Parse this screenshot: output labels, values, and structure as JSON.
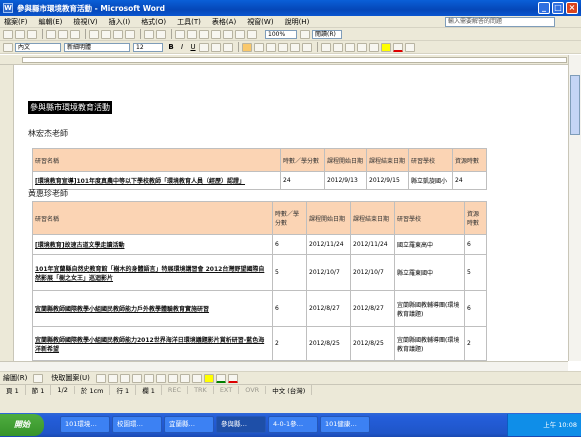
{
  "window": {
    "title": "參與縣市環境教育活動 - Microsoft Word"
  },
  "menu": [
    "檔案(F)",
    "編輯(E)",
    "檢視(V)",
    "插入(I)",
    "格式(O)",
    "工具(T)",
    "表格(A)",
    "視窗(W)",
    "說明(H)"
  ],
  "help_placeholder": "輸入需要解答的問題",
  "toolbar": {
    "zoom": "100%",
    "read": "閱讀(R)",
    "style": "內文",
    "font": "新細明體",
    "size": "12"
  },
  "doc": {
    "heading": "參與縣市環境教育活動",
    "teacher1": "林宏杰老師",
    "teacher2": "黃惠珍老師",
    "table1": {
      "headers": [
        "研習名稱",
        "時數／學分數",
        "課程開始日期",
        "課程結束日期",
        "研習學校",
        "資源時數"
      ],
      "rows": [
        [
          "[環境教育宣導]101年度真農中等以下學校教師「環境教育人員（經歷）認證」",
          "24",
          "2012/9/13",
          "2012/9/15",
          "縣立凱旋國小",
          "24"
        ]
      ]
    },
    "table2": {
      "headers": [
        "研習名稱",
        "時數／學分數",
        "課程開始日期",
        "課程結束日期",
        "研習學校",
        "資源時數"
      ],
      "rows": [
        [
          "[環境教育]故速古道文學走讀活動",
          "6",
          "2012/11/24",
          "2012/11/24",
          "國立羅東高中",
          "6"
        ],
        [
          "101年宜蘭縣自然史教育館「樹木的身體語言」特展環境講習會 2012台灣野望國際自然影展「樹之女王」巡迴影片",
          "5",
          "2012/10/7",
          "2012/10/7",
          "縣立羅東國中",
          "5"
        ],
        [
          "宜蘭縣教師國際教學小組國民教師能力戶外教學體驗教育實施研習",
          "6",
          "2012/8/27",
          "2012/8/27",
          "宜蘭縣國教輔導團(環境教育議題)",
          "6"
        ],
        [
          "宜蘭縣教師國際教學小組國民教師能力2012世界海洋日環境議題影片賞析研習-藍色海洋新希望",
          "2",
          "2012/8/25",
          "2012/8/25",
          "宜蘭縣國教輔導團(環境教育議題)",
          "2"
        ]
      ]
    }
  },
  "status": {
    "page": "頁 1",
    "section": "節 1",
    "pages": "1/2",
    "at": "於 1cm",
    "line": "行 1",
    "col": "欄 1",
    "rec": "REC",
    "trk": "TRK",
    "ext": "EXT",
    "ovr": "OVR",
    "lang": "中文 (台灣)"
  },
  "drawbar": {
    "draw": "繪圖(R)",
    "autoshape": "快取圖案(U)"
  },
  "taskbar": {
    "start": "開始",
    "tasks": [
      "101環境…",
      "校園環…",
      "宜蘭縣…",
      "參與縣…",
      "4-0-1參…",
      "101健康…"
    ],
    "time": "上午 10:08"
  }
}
